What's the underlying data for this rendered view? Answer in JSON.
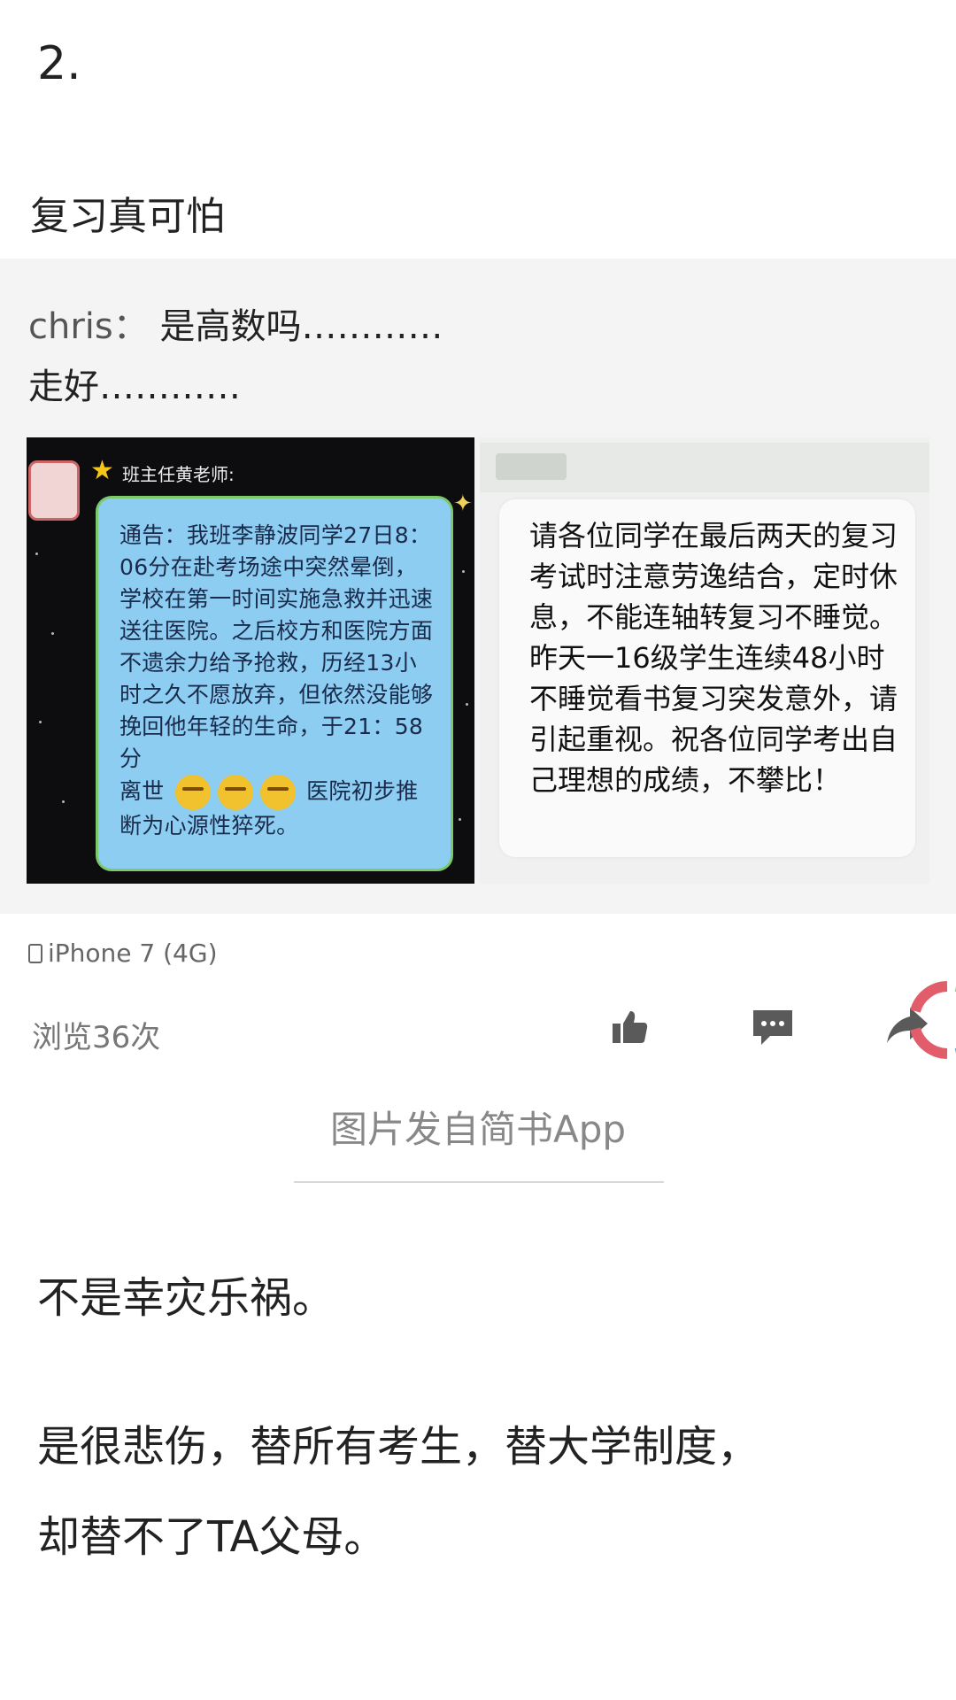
{
  "post": {
    "number": "2.",
    "title": "复习真可怕"
  },
  "screenshot": {
    "comment": {
      "author": "chris：",
      "line1": "是高数吗…………",
      "line2": "走好…………"
    },
    "left_chat": {
      "sender": "班主任黄老师:",
      "message_part1": "通告：我班李静波同学27日8：06分在赴考场途中突然晕倒，学校在第一时间实施急救并迅速送往医院。之后校方和医院方面不遗余力给予抢救，历经13小时之久不愿放弃，但依然没能够挽回他年轻的生命，于21：58分",
      "message_part2_prefix": "离世",
      "message_part2_suffix": "医院初步推断为心源性猝死。"
    },
    "right_sms": {
      "message": "请各位同学在最后两天的复习考试时注意劳逸结合，定时休息，不能连轴转复习不睡觉。昨天一16级学生连续48小时不睡觉看书复习突发意外，请引起重视。祝各位同学考出自己理想的成绩，不攀比！"
    },
    "device": "iPhone 7 (4G)",
    "views": "浏览36次",
    "icons": {
      "like": "thumbs-up-icon",
      "comment": "comment-icon",
      "share": "share-icon"
    }
  },
  "caption": "图片发自简书App",
  "body": {
    "p1": "不是幸灾乐祸。",
    "p2": "是很悲伤，替所有考生，替大学制度，",
    "p3": "却替不了TA父母。"
  },
  "colors": {
    "chat_bubble": "#8ccdf1",
    "sms_bubble": "#fafafa",
    "caption_text": "#888888"
  }
}
